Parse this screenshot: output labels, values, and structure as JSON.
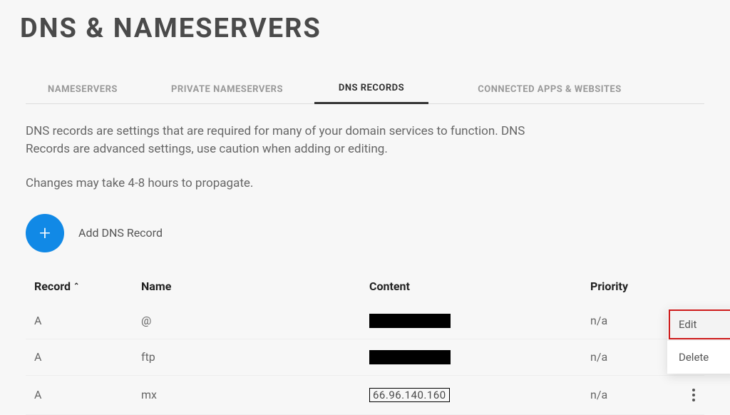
{
  "page": {
    "title": "DNS & NAMESERVERS"
  },
  "tabs": [
    {
      "label": "NAMESERVERS"
    },
    {
      "label": "PRIVATE NAMESERVERS"
    },
    {
      "label": "DNS RECORDS"
    },
    {
      "label": "CONNECTED APPS & WEBSITES"
    }
  ],
  "description": {
    "p1": "DNS records are settings that are required for many of your domain services to function. DNS Records are advanced settings, use caution when adding or editing.",
    "p2": "Changes may take 4-8 hours to propagate."
  },
  "add": {
    "label": "Add DNS Record"
  },
  "table": {
    "headers": {
      "record": "Record",
      "name": "Name",
      "content": "Content",
      "priority": "Priority"
    },
    "rows": [
      {
        "record": "A",
        "name": "@",
        "content_hidden": true,
        "content": "",
        "priority": "n/a"
      },
      {
        "record": "A",
        "name": "ftp",
        "content_hidden": true,
        "content": "",
        "priority": "n/a"
      },
      {
        "record": "A",
        "name": "mx",
        "content_hidden": false,
        "content": "66.96.140.160",
        "priority": "n/a"
      }
    ]
  },
  "menu": {
    "edit": "Edit",
    "delete": "Delete"
  }
}
